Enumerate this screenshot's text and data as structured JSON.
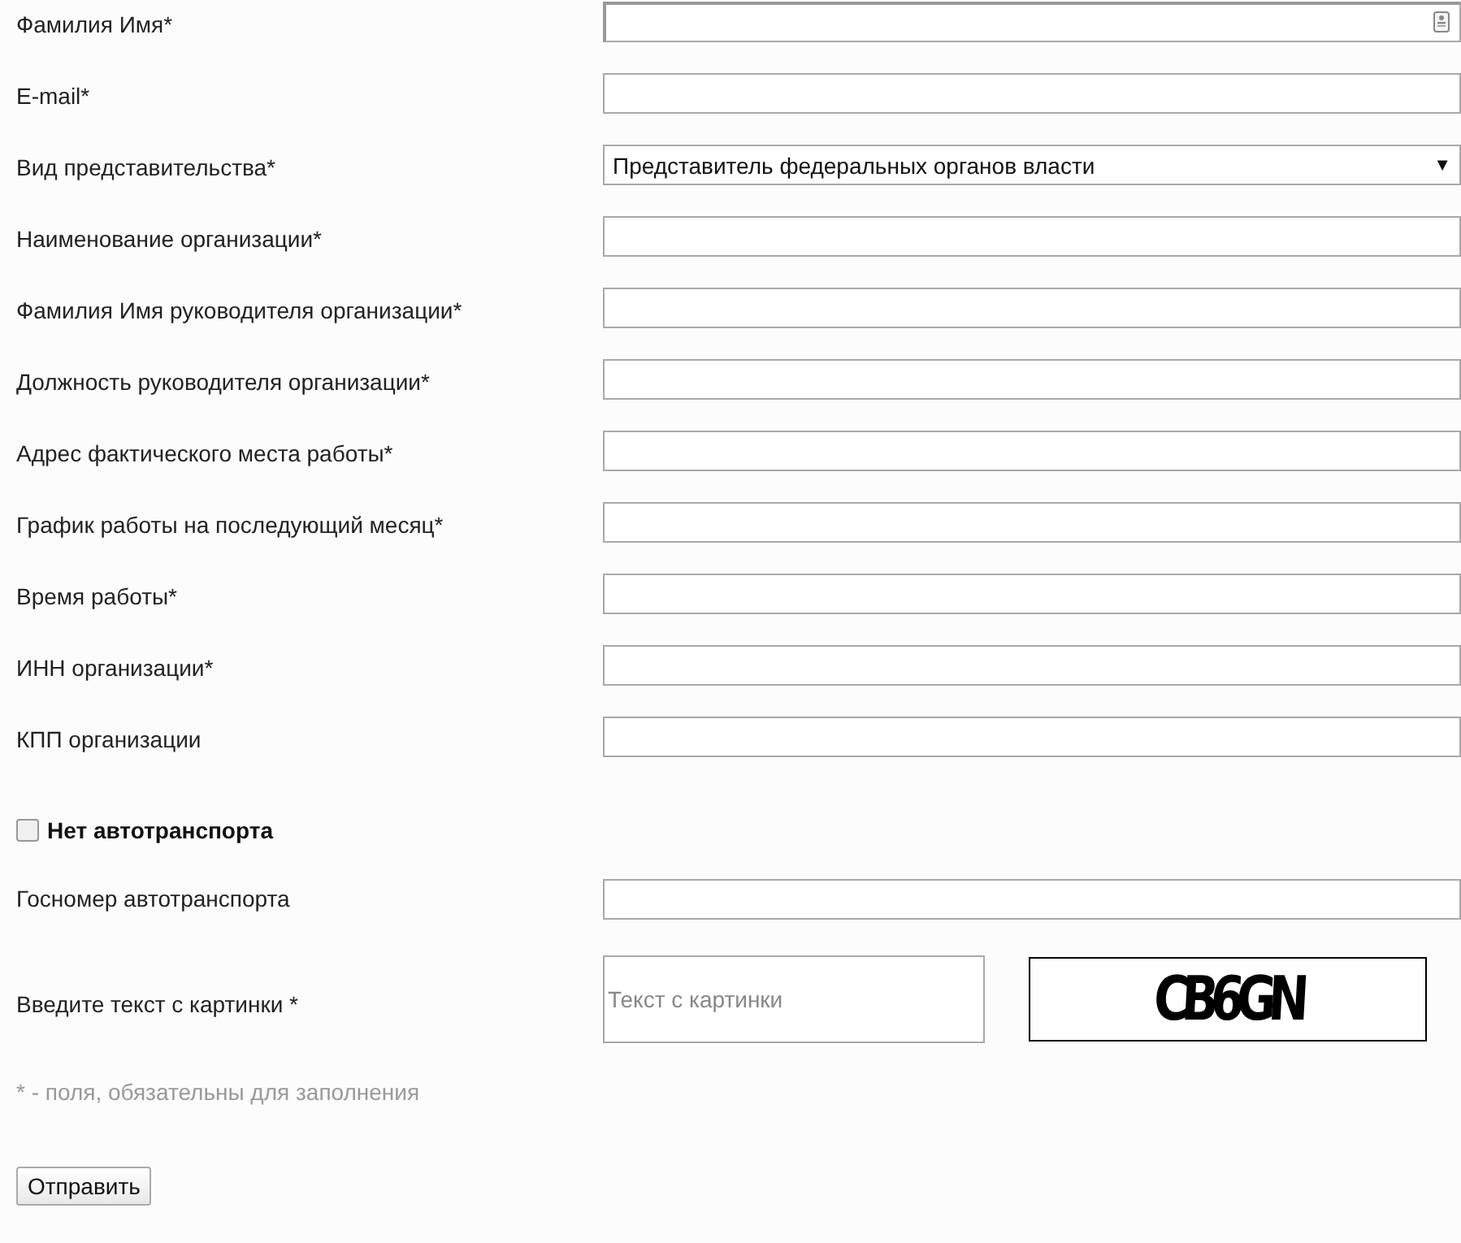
{
  "fields": [
    {
      "label": "Фамилия Имя*",
      "kind": "text",
      "autofill_icon": true
    },
    {
      "label": "E-mail*",
      "kind": "text",
      "autofill_icon": false
    },
    {
      "label": "Вид представительства*",
      "kind": "select",
      "value": "Представитель федеральных органов власти",
      "caret": "▼"
    },
    {
      "label": "Наименование организации*",
      "kind": "text",
      "autofill_icon": false
    },
    {
      "label": "Фамилия Имя руководителя организации*",
      "kind": "text",
      "autofill_icon": false
    },
    {
      "label": "Должность руководителя организации*",
      "kind": "text",
      "autofill_icon": false
    },
    {
      "label": "Адрес фактического места работы*",
      "kind": "text",
      "autofill_icon": false
    },
    {
      "label": "График работы на последующий месяц*",
      "kind": "text",
      "autofill_icon": false
    },
    {
      "label": "Время работы*",
      "kind": "text",
      "autofill_icon": false
    },
    {
      "label": "ИНН организации*",
      "kind": "text",
      "autofill_icon": false
    },
    {
      "label": "КПП организации",
      "kind": "text",
      "autofill_icon": false
    }
  ],
  "no_vehicle": {
    "label": "Нет автотранспорта",
    "checked": false
  },
  "plate": {
    "label": "Госномер автотранспорта"
  },
  "captcha": {
    "label": "Введите текст с картинки *",
    "placeholder": "Текст с картинки",
    "image_text": "CB6GN"
  },
  "footnote": "* - поля, обязательны для заполнения",
  "submit": "Отправить"
}
